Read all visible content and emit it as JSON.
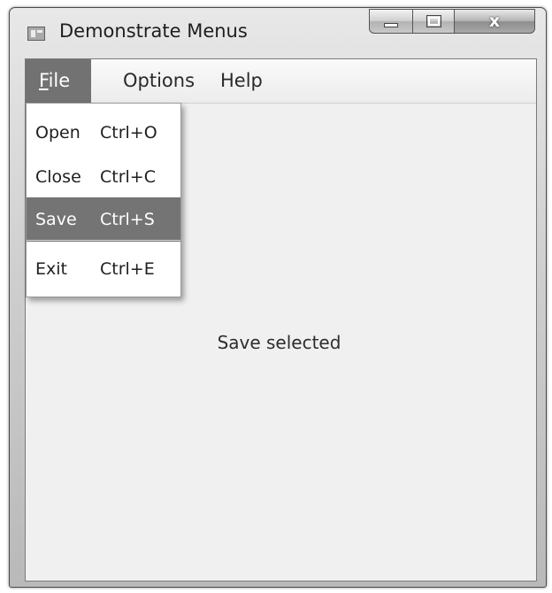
{
  "window": {
    "title": "Demonstrate Menus",
    "controls": {
      "minimize": "minimize",
      "maximize": "maximize",
      "close": "x"
    }
  },
  "menubar": {
    "items": [
      {
        "label": "File",
        "mnemonic": "F",
        "rest": "ile",
        "open": true
      },
      {
        "label": "Options"
      },
      {
        "label": "Help"
      }
    ]
  },
  "file_menu": {
    "items": [
      {
        "label": "Open",
        "shortcut": "Ctrl+O",
        "selected": false
      },
      {
        "label": "Close",
        "shortcut": "Ctrl+C",
        "selected": false
      },
      {
        "label": "Save",
        "shortcut": "Ctrl+S",
        "selected": true
      },
      {
        "label": "Exit",
        "shortcut": "Ctrl+E",
        "selected": false
      }
    ]
  },
  "content": {
    "status": "Save selected"
  },
  "colors": {
    "menu_highlight": "#747474",
    "client_background": "#f0f0f0"
  },
  "icons": {
    "app": "window-app-icon",
    "minimize": "minimize-icon",
    "maximize": "maximize-icon",
    "close": "close-icon"
  }
}
